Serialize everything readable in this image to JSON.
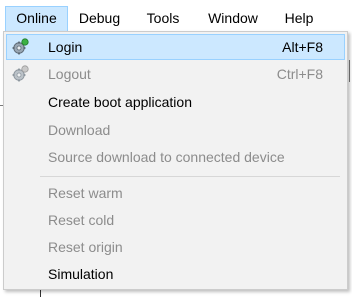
{
  "menubar": {
    "items": [
      {
        "label": "Online"
      },
      {
        "label": "Debug"
      },
      {
        "label": "Tools"
      },
      {
        "label": "Window"
      },
      {
        "label": "Help"
      }
    ]
  },
  "dropdown": {
    "items": [
      {
        "label": "Login",
        "shortcut": "Alt+F8",
        "enabled": true,
        "highlighted": true,
        "icon": "login-gear-icon"
      },
      {
        "label": "Logout",
        "shortcut": "Ctrl+F8",
        "enabled": false,
        "icon": "logout-gear-icon"
      },
      {
        "label": "Create boot application",
        "shortcut": "",
        "enabled": true
      },
      {
        "label": "Download",
        "shortcut": "",
        "enabled": false
      },
      {
        "label": "Source download to connected device",
        "shortcut": "",
        "enabled": false
      },
      {
        "label": "Reset warm",
        "shortcut": "",
        "enabled": false
      },
      {
        "label": "Reset cold",
        "shortcut": "",
        "enabled": false
      },
      {
        "label": "Reset origin",
        "shortcut": "",
        "enabled": false
      },
      {
        "label": "Simulation",
        "shortcut": "",
        "enabled": true
      }
    ]
  },
  "colors": {
    "highlight_bg": "#cce8ff",
    "highlight_border": "#99d1ff",
    "menu_bg": "#f2f2f2",
    "disabled_text": "#8c8c8c",
    "icon_green": "#3cb043"
  }
}
